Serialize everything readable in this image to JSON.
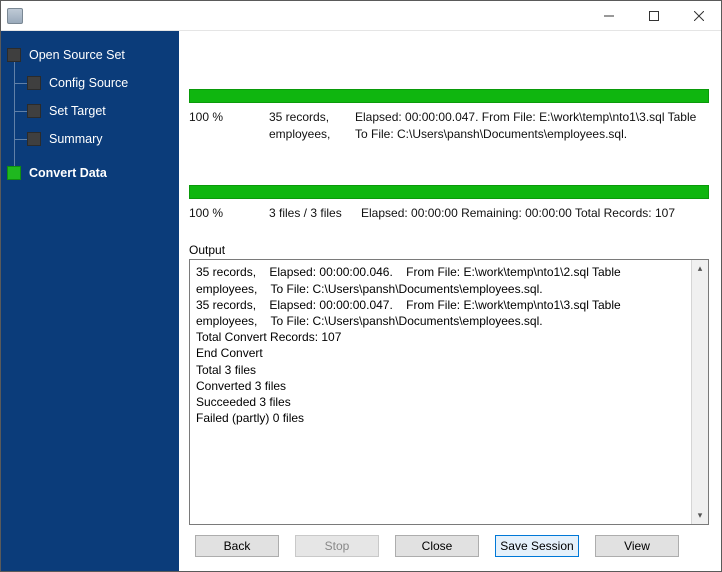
{
  "window": {
    "title": ""
  },
  "sidebar": {
    "items": [
      {
        "label": "Open Source Set",
        "active": false,
        "indent": false
      },
      {
        "label": "Config Source",
        "active": false,
        "indent": true
      },
      {
        "label": "Set Target",
        "active": false,
        "indent": true
      },
      {
        "label": "Summary",
        "active": false,
        "indent": true
      },
      {
        "label": "Convert Data",
        "active": true,
        "indent": false
      }
    ]
  },
  "progress1": {
    "percent_label": "100 %",
    "col2_line1": "35 records,",
    "col2_line2": "employees,",
    "rest_line1": "Elapsed: 00:00:00.047.    From File: E:\\work\\temp\\nto1\\3.sql Table",
    "rest_line2": "To File: C:\\Users\\pansh\\Documents\\employees.sql."
  },
  "progress2": {
    "percent_label": "100 %",
    "col2": "3 files / 3 files",
    "rest": "Elapsed: 00:00:00      Remaining: 00:00:00      Total Records: 107"
  },
  "output": {
    "label": "Output",
    "lines": [
      "35 records,    Elapsed: 00:00:00.046.    From File: E:\\work\\temp\\nto1\\2.sql Table employees,    To File: C:\\Users\\pansh\\Documents\\employees.sql.",
      "35 records,    Elapsed: 00:00:00.047.    From File: E:\\work\\temp\\nto1\\3.sql Table employees,    To File: C:\\Users\\pansh\\Documents\\employees.sql.",
      "Total Convert Records: 107",
      "End Convert",
      "Total 3 files",
      "Converted 3 files",
      "Succeeded 3 files",
      "Failed (partly) 0 files"
    ]
  },
  "buttons": {
    "back": "Back",
    "stop": "Stop",
    "close": "Close",
    "save_session": "Save Session",
    "view": "View"
  },
  "colors": {
    "sidebar_bg": "#0b3c7a",
    "progress_green": "#0fb60f",
    "primary_border": "#0078d7"
  }
}
